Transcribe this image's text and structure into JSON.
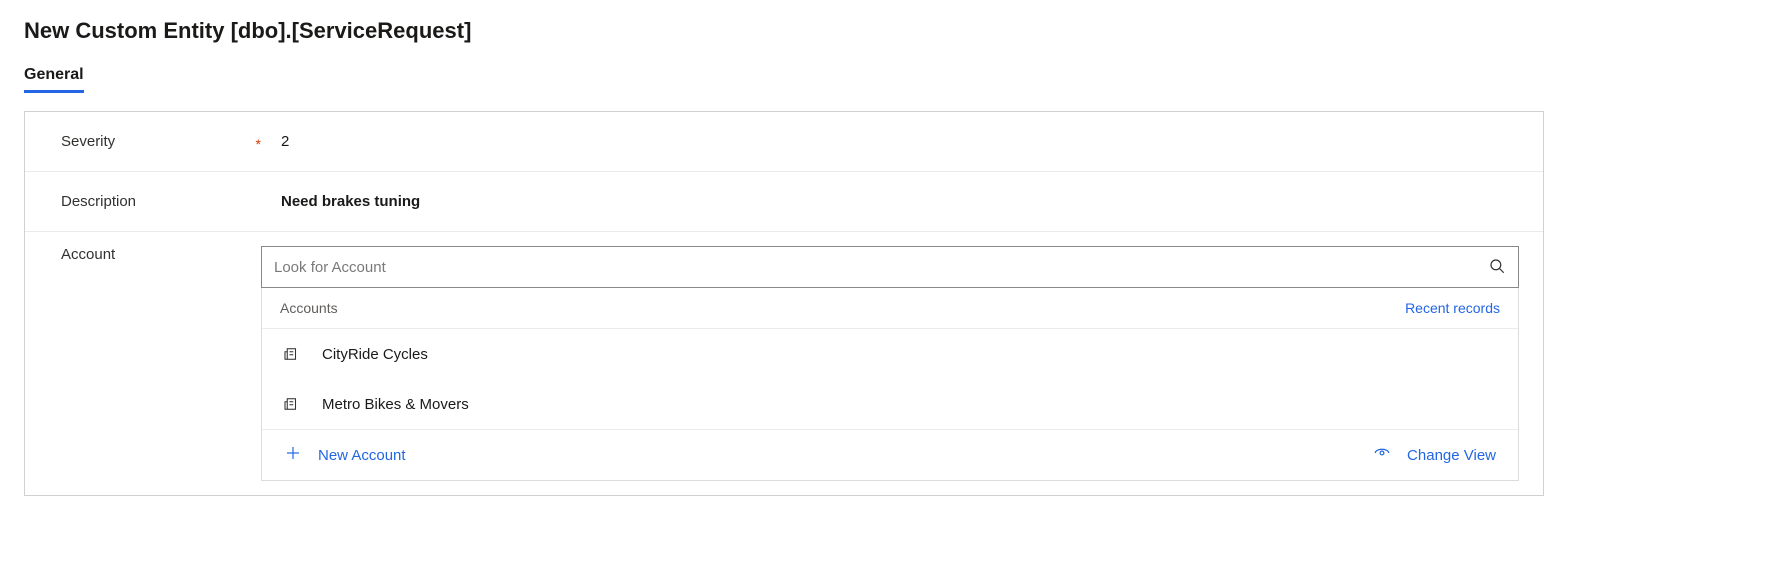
{
  "page": {
    "title": "New Custom Entity [dbo].[ServiceRequest]"
  },
  "tabs": [
    {
      "label": "General",
      "active": true
    }
  ],
  "form": {
    "severity": {
      "label": "Severity",
      "required": true,
      "value": "2"
    },
    "description": {
      "label": "Description",
      "required": false,
      "value": "Need brakes tuning"
    },
    "account": {
      "label": "Account",
      "required": false,
      "placeholder": "Look for Account",
      "value": ""
    }
  },
  "lookup": {
    "section_label": "Accounts",
    "recent_label": "Recent records",
    "items": [
      {
        "name": "CityRide Cycles"
      },
      {
        "name": "Metro Bikes & Movers"
      }
    ],
    "new_label": "New Account",
    "change_view_label": "Change View"
  }
}
